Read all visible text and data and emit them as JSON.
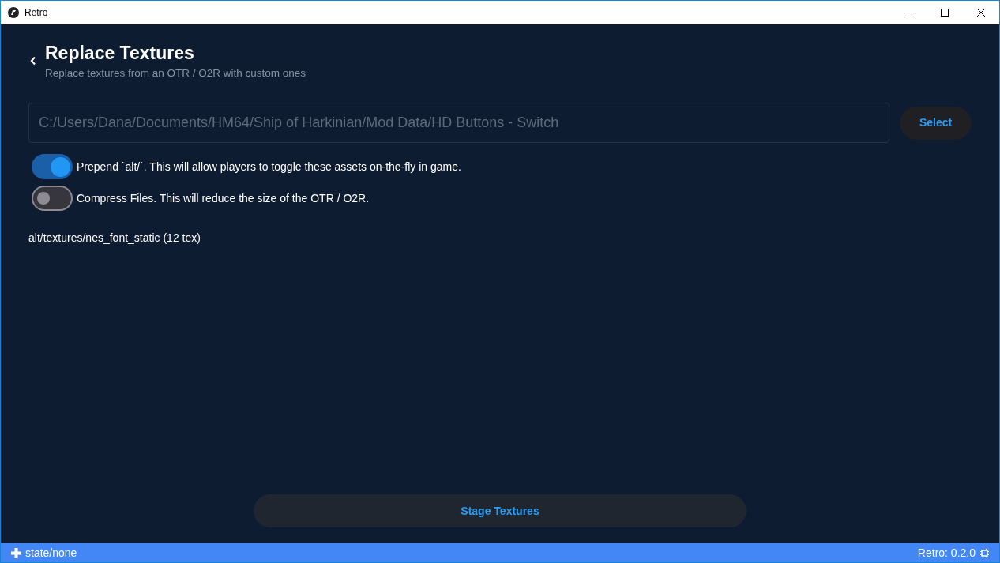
{
  "window": {
    "title": "Retro"
  },
  "header": {
    "title": "Replace Textures",
    "subtitle": "Replace textures from an OTR / O2R with custom ones"
  },
  "path_field": {
    "value": "C:/Users/Dana/Documents/HM64/Ship of Harkinian/Mod Data/HD Buttons - Switch"
  },
  "select_button": "Select",
  "toggles": [
    {
      "label": "Prepend `alt/`. This will allow players to toggle these assets on-the-fly in game.",
      "on": true
    },
    {
      "label": "Compress Files. This will reduce the size of the OTR / O2R.",
      "on": false
    }
  ],
  "entries": [
    "alt/textures/nes_font_static (12 tex)"
  ],
  "stage_button": "Stage Textures",
  "status_bar": {
    "state": "state/none",
    "version": "Retro: 0.2.0"
  }
}
